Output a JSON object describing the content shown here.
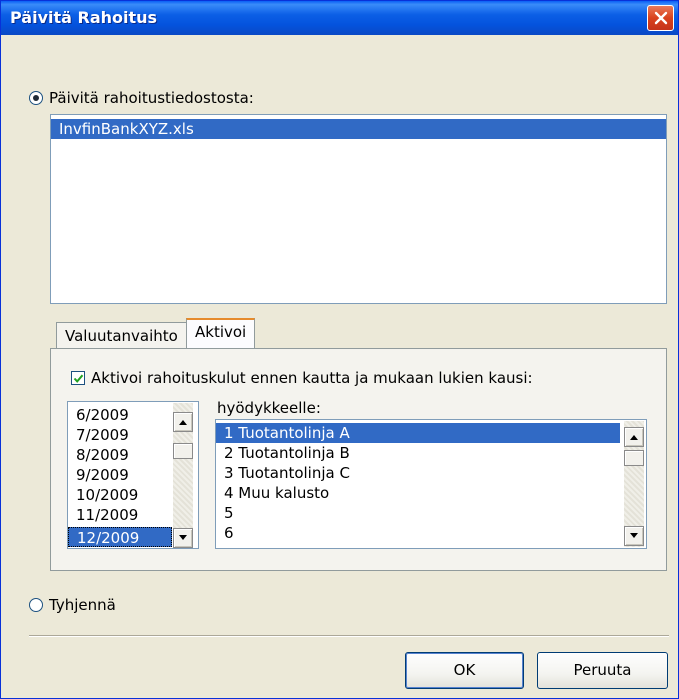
{
  "window": {
    "title": "Päivitä Rahoitus"
  },
  "update_option": {
    "label": "Päivitä rahoitustiedostosta:",
    "selected": true,
    "files": [
      "InvfinBankXYZ.xls"
    ],
    "selected_file": "InvfinBankXYZ.xls"
  },
  "tabs": [
    {
      "label": "Valuutanvaihto",
      "active": false
    },
    {
      "label": "Aktivoi",
      "active": true
    }
  ],
  "activate_tab": {
    "checkbox_label": "Aktivoi rahoituskulut ennen kautta ja mukaan lukien kausi:",
    "checkbox_checked": true,
    "periods": [
      "6/2009",
      "7/2009",
      "8/2009",
      "9/2009",
      "10/2009",
      "11/2009",
      "12/2009"
    ],
    "selected_period": "12/2009",
    "assets_label": "hyödykkeelle:",
    "assets": [
      "1 Tuotantolinja A",
      "2 Tuotantolinja B",
      "3 Tuotantolinja C",
      "4 Muu kalusto",
      "5",
      "6"
    ],
    "selected_asset": "1 Tuotantolinja A"
  },
  "clear_option": {
    "label": "Tyhjennä",
    "selected": false
  },
  "buttons": {
    "ok": "OK",
    "cancel": "Peruuta"
  },
  "colors": {
    "selection": "#316ac5",
    "titlebar": "#0453dd",
    "face": "#ece9d8"
  }
}
